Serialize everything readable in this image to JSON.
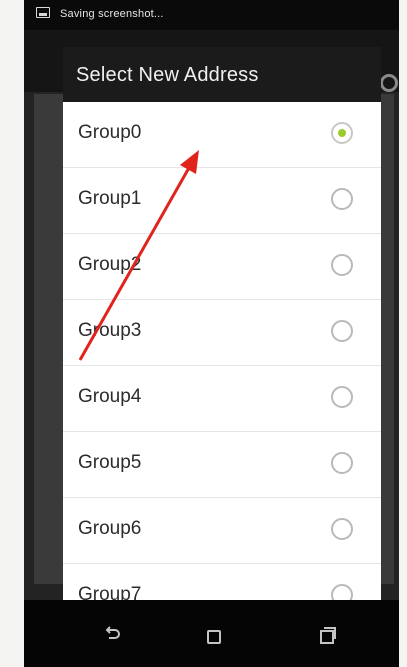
{
  "status_bar": {
    "icon": "screenshot-icon",
    "text": "Saving screenshot..."
  },
  "dialog": {
    "title": "Select New Address",
    "options": [
      {
        "label": "Group0",
        "selected": true
      },
      {
        "label": "Group1",
        "selected": false
      },
      {
        "label": "Group2",
        "selected": false
      },
      {
        "label": "Group3",
        "selected": false
      },
      {
        "label": "Group4",
        "selected": false
      },
      {
        "label": "Group5",
        "selected": false
      },
      {
        "label": "Group6",
        "selected": false
      },
      {
        "label": "Group7",
        "selected": false
      }
    ]
  },
  "nav_bar": {
    "icons": [
      "back-icon",
      "home-icon",
      "recents-icon"
    ]
  },
  "colors": {
    "radio_selected": "#9ccc2c",
    "annotation_arrow": "#e0231c",
    "dialog_title_bg": "#1b1b1b"
  }
}
